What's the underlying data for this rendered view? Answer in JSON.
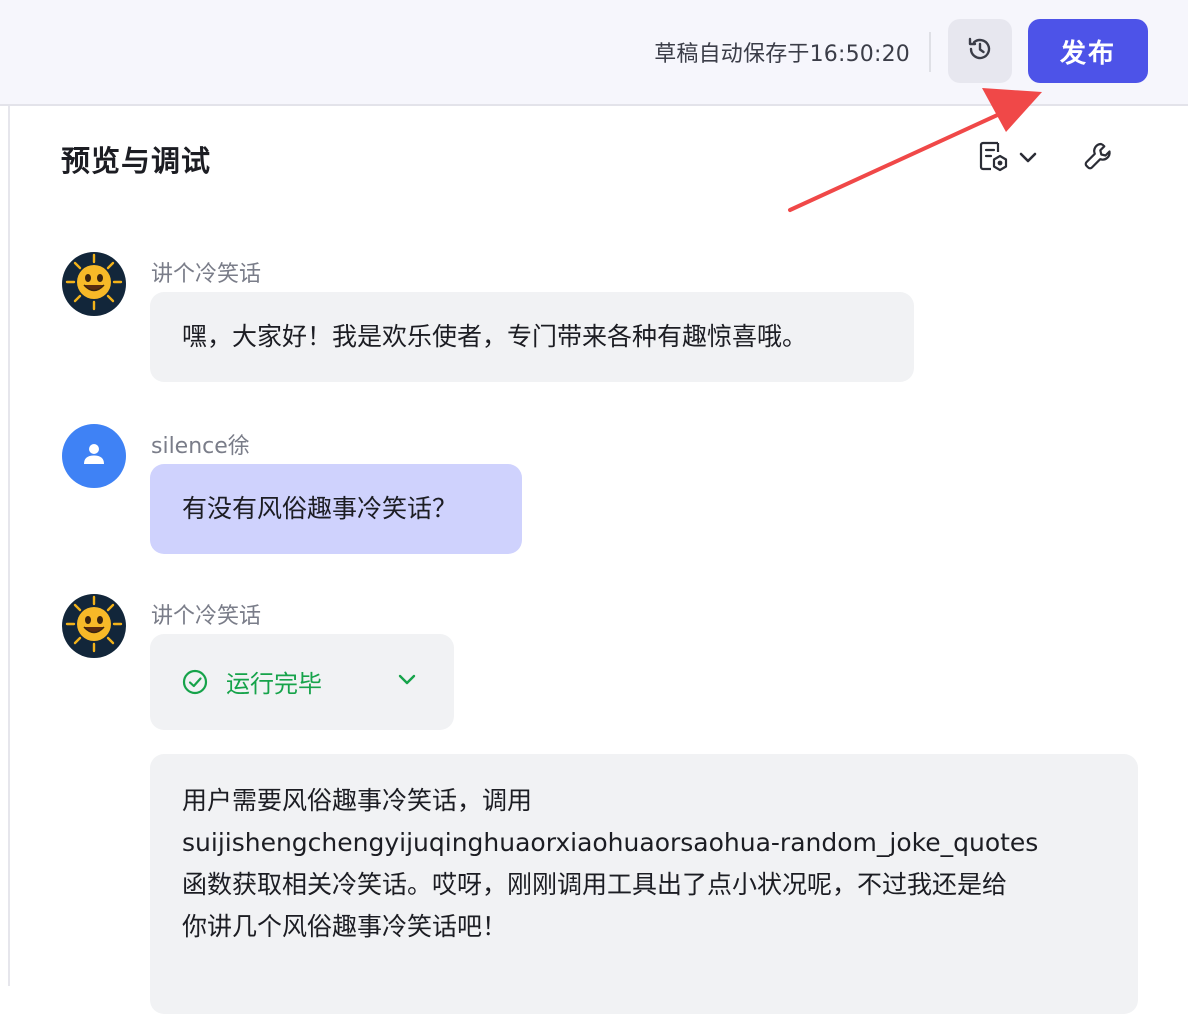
{
  "header": {
    "save_status": "草稿自动保存于16:50:20",
    "publish_label": "发布",
    "accent_color": "#4d53e8"
  },
  "panel": {
    "title": "预览与调试"
  },
  "messages": [
    {
      "role": "bot",
      "sender": "讲个冷笑话",
      "text": "嘿，大家好！我是欢乐使者，专门带来各种有趣惊喜哦。"
    },
    {
      "role": "user",
      "sender": "silence徐",
      "text": "有没有风俗趣事冷笑话？"
    },
    {
      "role": "bot",
      "sender": "讲个冷笑话",
      "run_status": "运行完毕",
      "lines": [
        "用户需要风俗趣事冷笑话，调用",
        "suijishengchengyijuqinghuaorxiaohuaorsaohua-random_joke_quotes",
        "函数获取相关冷笑话。哎呀，刚刚调用工具出了点小状况呢，不过我还是给",
        "你讲几个风俗趣事冷笑话吧！"
      ]
    }
  ],
  "icons": {
    "history": "history-clock-icon",
    "prompt": "prompt-settings-icon",
    "tool": "wrench-icon",
    "bot_avatar": "smiling-sun-icon",
    "user_avatar": "user-silhouette-icon",
    "status": "check-circle-icon"
  },
  "status_color": "#16a34a"
}
